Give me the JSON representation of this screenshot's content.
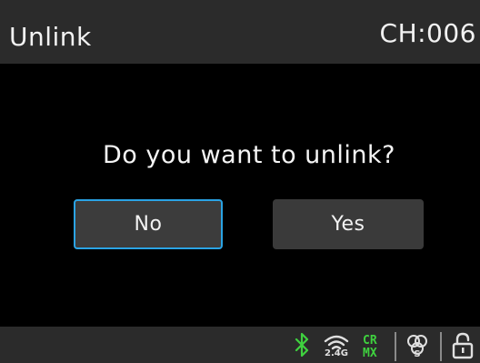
{
  "header": {
    "title": "Unlink",
    "channel": "CH:006"
  },
  "dialog": {
    "question": "Do you want to unlink?",
    "no_label": "No",
    "yes_label": "Yes"
  },
  "status_bar": {
    "wifi_label": "2.4G",
    "mode_top": "CR",
    "mode_bottom": "MX",
    "icons": [
      "bluetooth-icon",
      "wifi-2-4g-icon",
      "crmx-icon",
      "cs-link-icon",
      "lock-open-icon"
    ]
  },
  "colors": {
    "selection_border": "#2aa3e4",
    "status_green": "#3fd13f",
    "header_bg": "#2b2b2b"
  }
}
